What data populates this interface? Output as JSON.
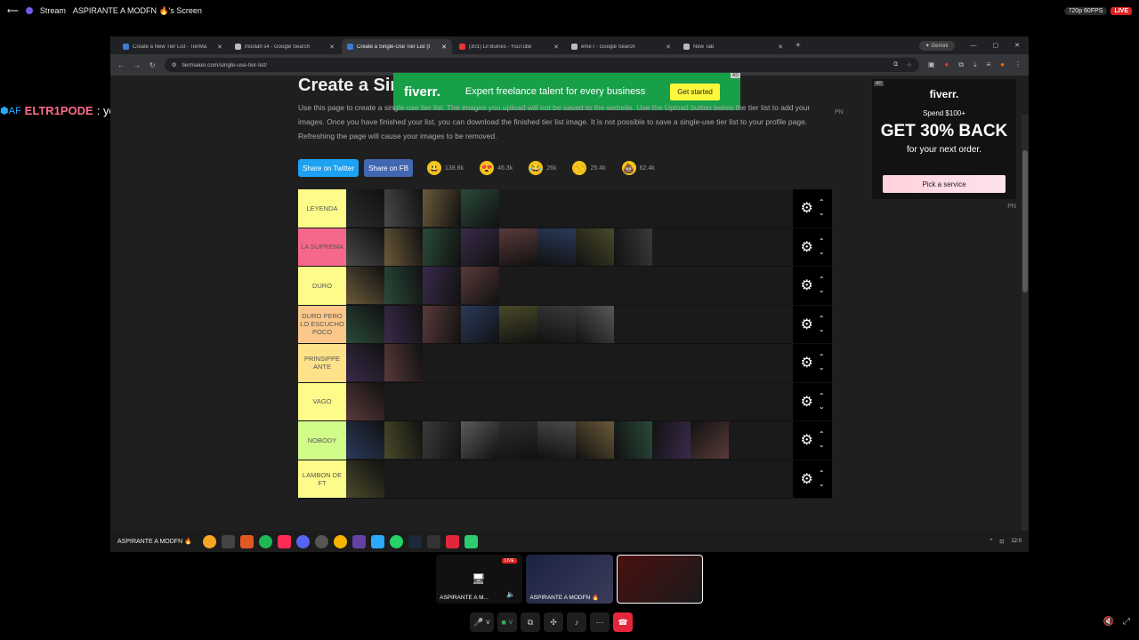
{
  "discord": {
    "stream_label": "Stream",
    "screen_title": "ASPIRANTE A MODFN 🔥's Screen",
    "quality_badge": "720p 60FPS",
    "live_badge": "LIVE"
  },
  "chat": {
    "prefix": "⬢AF",
    "user": "ELTR1PODE",
    "message": ": yeee"
  },
  "browser": {
    "tabs": [
      {
        "title": "Create a New Tier List - TierMa",
        "color": "#3a7bd5"
      },
      {
        "title": "moolah s4 - Google Search",
        "color": "#bbb"
      },
      {
        "title": "Create a Single-Use Tier List (t",
        "color": "#3a7bd5",
        "active": true
      },
      {
        "title": "(301) Lil Bulnes - YouTube",
        "color": "#e33"
      },
      {
        "title": "eme r - Google Search",
        "color": "#bbb"
      },
      {
        "title": "New Tab",
        "color": "#bbb"
      }
    ],
    "new_tab": "+",
    "gemini": "✦ Gemini",
    "url": "tiermaker.com/single-use-tier-list/"
  },
  "page": {
    "title": "Create a Single-Use Tier List",
    "description": "Use this page to create a single-use tier list. The images you upload will not be saved to the website. Use the Upload button below the tier list to add your images. Once you have finished your list, you can download the finished tier list image. It is not possible to save a single-use tier list to your profile page. Refreshing the page will cause your images to be removed.",
    "pn": "PN",
    "share_twitter": "Share on Twitter",
    "share_fb": "Share on FB",
    "reactions": [
      {
        "emoji": "😃",
        "count": "138.8k"
      },
      {
        "emoji": "😍",
        "count": "46.3k"
      },
      {
        "emoji": "😂",
        "count": "26k"
      },
      {
        "emoji": "🙌",
        "count": "25.4k"
      },
      {
        "emoji": "💩",
        "count": "62.4k"
      }
    ],
    "ad_banner": {
      "logo": "fiverr.",
      "text": "Expert freelance talent for every business",
      "button": "Get started",
      "tag": "AD"
    },
    "side_ad": {
      "logo": "fiverr.",
      "line1": "Spend $100+",
      "headline": "GET 30% BACK",
      "line2": "for your next order.",
      "button": "Pick a service",
      "tag": "AD",
      "pn": "PN"
    }
  },
  "tiers": [
    {
      "label": "LEYENDA",
      "color": "#fdfc8a",
      "tiles": 4
    },
    {
      "label": "LA SUPREMA",
      "color": "#f6688b",
      "tiles": 8
    },
    {
      "label": "DURO",
      "color": "#fdfc8a",
      "tiles": 4
    },
    {
      "label": "DURO PERO LO ESCUCHO POCO",
      "color": "#fcc88a",
      "tiles": 7
    },
    {
      "label": "PRINSIPPE ANTE",
      "color": "#fde28a",
      "tiles": 2
    },
    {
      "label": "VAGO",
      "color": "#fdfc8a",
      "tiles": 1
    },
    {
      "label": "NOBODY",
      "color": "#d1fc8a",
      "tiles": 10
    },
    {
      "label": "LAMBON DE FT",
      "color": "#fdfc8a",
      "tiles": 1
    }
  ],
  "taskbar": {
    "label": "ASPIRANTE A MODFN 🔥",
    "time": "12:0"
  },
  "call": {
    "tiles": [
      {
        "label": "ASPIRANTE A M...",
        "live": "LIVE"
      },
      {
        "label": "ASPIRANTE A MODFN 🔥"
      },
      {
        "label": ""
      }
    ]
  }
}
